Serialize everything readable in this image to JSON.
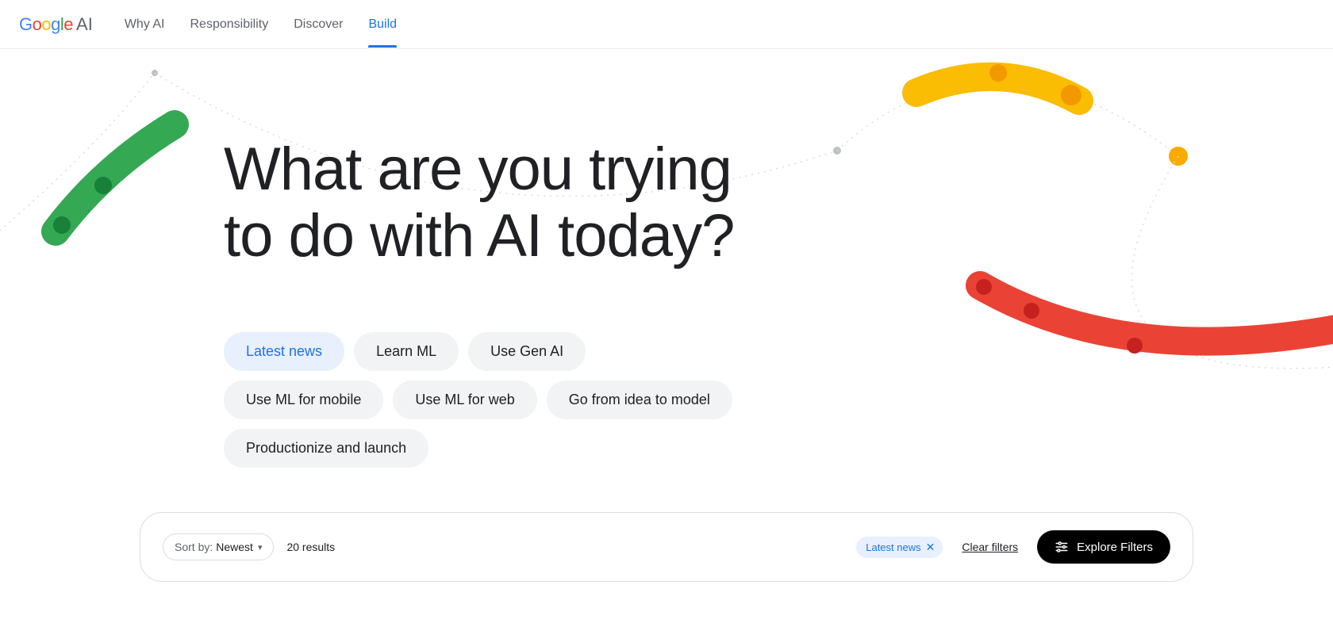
{
  "header": {
    "logo": {
      "brand": "Google",
      "suffix": "AI"
    },
    "nav": [
      {
        "label": "Why AI",
        "active": false
      },
      {
        "label": "Responsibility",
        "active": false
      },
      {
        "label": "Discover",
        "active": false
      },
      {
        "label": "Build",
        "active": true
      }
    ]
  },
  "hero": {
    "title": "What are you trying to do with AI today?"
  },
  "pills": [
    {
      "label": "Latest news",
      "active": true
    },
    {
      "label": "Learn ML",
      "active": false
    },
    {
      "label": "Use Gen AI",
      "active": false
    },
    {
      "label": "Use ML for mobile",
      "active": false
    },
    {
      "label": "Use ML for web",
      "active": false
    },
    {
      "label": "Go from idea to model",
      "active": false
    },
    {
      "label": "Productionize and launch",
      "active": false
    }
  ],
  "results": {
    "sort_label": "Sort by:",
    "sort_value": "Newest",
    "count_text": "20 results",
    "active_chip": "Latest news",
    "clear_filters": "Clear filters",
    "explore_filters": "Explore Filters"
  }
}
